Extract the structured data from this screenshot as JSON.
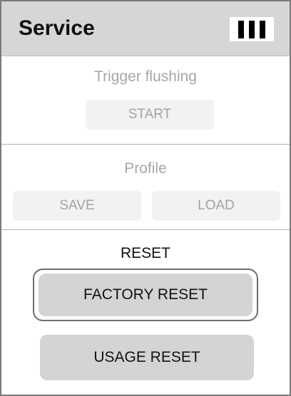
{
  "header": {
    "title": "Service",
    "status_icon": "battery-full-icon"
  },
  "flushing": {
    "label": "Trigger flushing",
    "start_button": "START"
  },
  "profile": {
    "label": "Profile",
    "save_button": "SAVE",
    "load_button": "LOAD"
  },
  "reset": {
    "label": "RESET",
    "factory_reset_button": "FACTORY RESET",
    "usage_reset_button": "USAGE RESET"
  },
  "colors": {
    "header_bg": "#d6d6d6",
    "disabled_text": "#a6a6a6",
    "active_button_bg": "#d4d4d4"
  }
}
